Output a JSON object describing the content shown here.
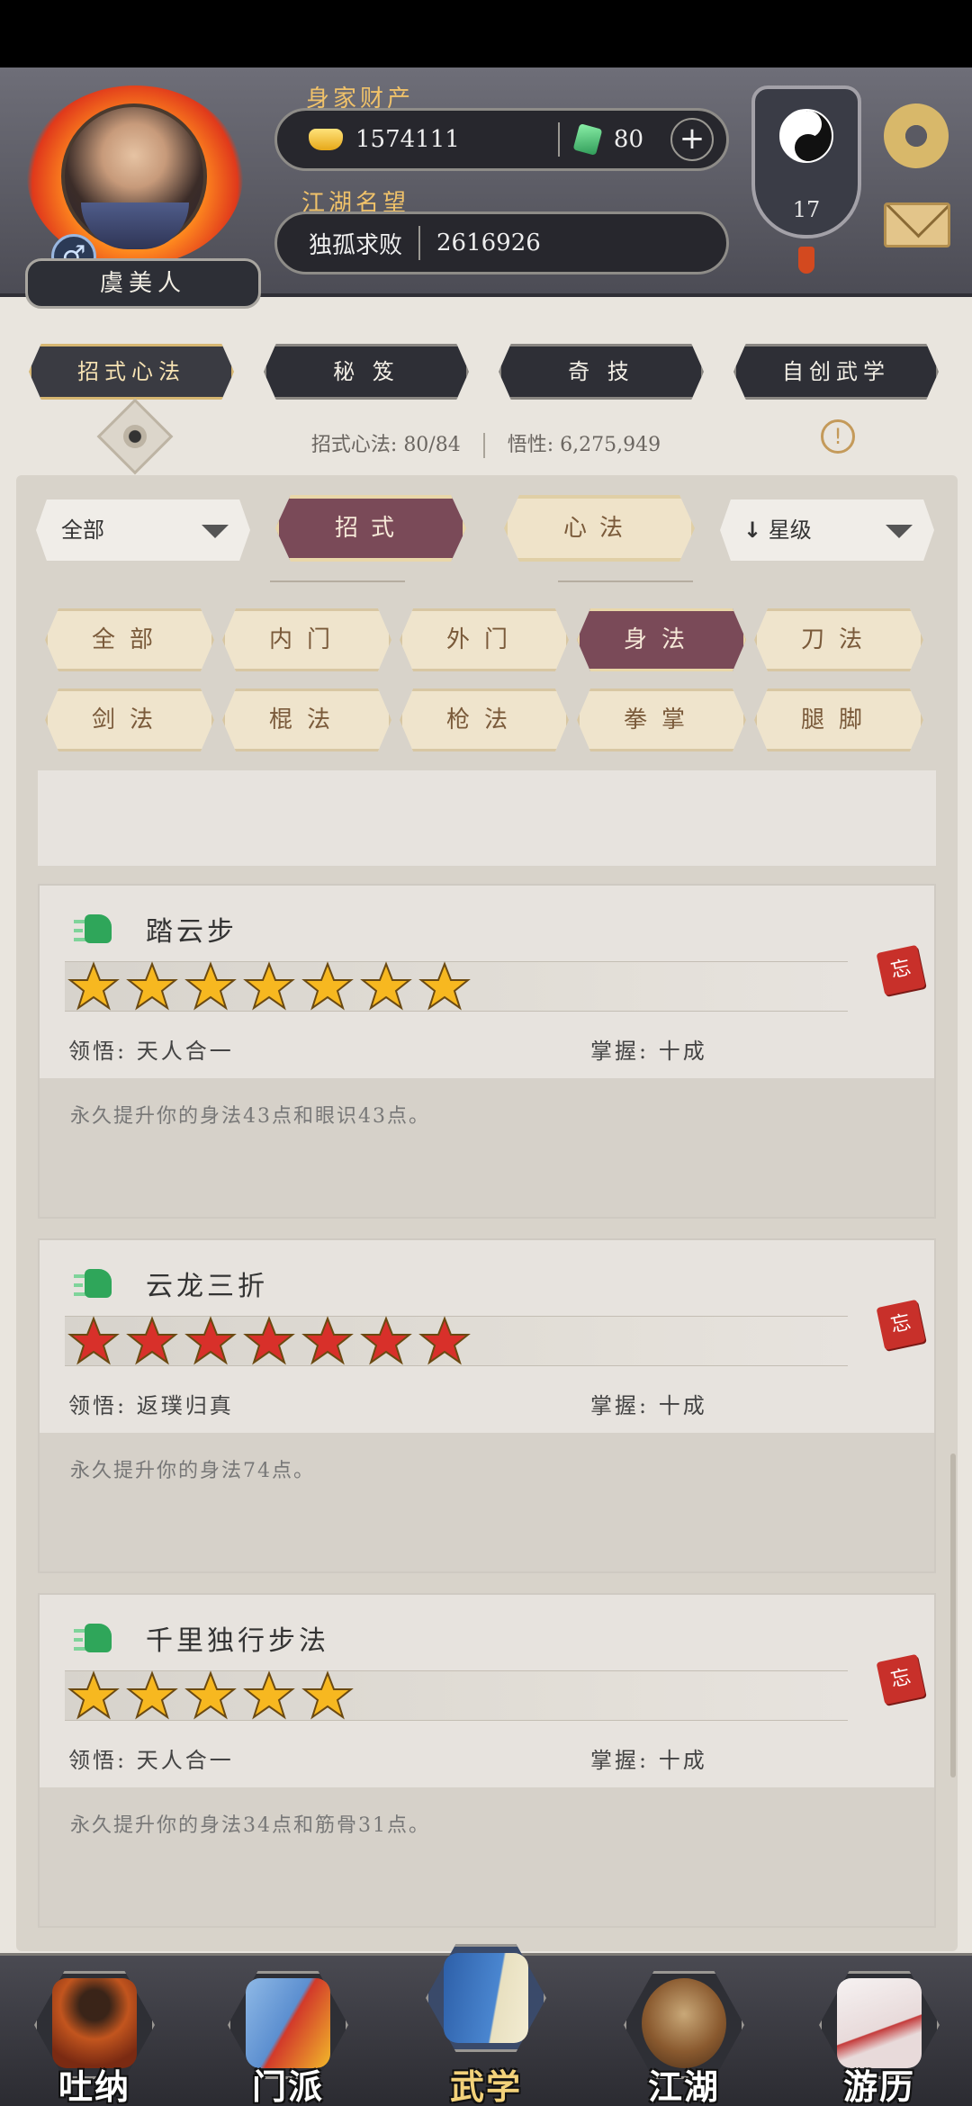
{
  "colors": {
    "accent_maroon": "#7a4a58",
    "accent_gold": "#f0c26a",
    "star_gold": "#f7b820",
    "star_red": "#d8302a",
    "forget_red": "#c8302a"
  },
  "header": {
    "wealth_label": "身家财产",
    "gold_value": "1574111",
    "jade_value": "80",
    "fame_label": "江湖名望",
    "fame_title": "独孤求败",
    "fame_value": "2616926",
    "player_name": "虞美人",
    "gender_symbol": "♂",
    "level": "17",
    "icons": [
      "gold-ingot-icon",
      "jade-icon",
      "plus-icon",
      "taiji-icon",
      "gear-icon",
      "mail-icon"
    ]
  },
  "top_tabs": [
    {
      "label": "招式心法",
      "active": true
    },
    {
      "label": "秘 笈",
      "active": false
    },
    {
      "label": "奇 技",
      "active": false
    },
    {
      "label": "自创武学",
      "active": false
    }
  ],
  "stats": {
    "moves_label": "招式心法:",
    "moves_value": "80/84",
    "comprehension_label": "悟性:",
    "comprehension_value": "6,275,949",
    "info_glyph": "!"
  },
  "filters": {
    "scope_dropdown": "全部",
    "main_tabs": [
      {
        "label": "招式",
        "active": true
      },
      {
        "label": "心法",
        "active": false
      }
    ],
    "sort_dropdown": "星级",
    "sort_arrow": "↓",
    "categories": [
      {
        "label": "全部",
        "active": false
      },
      {
        "label": "内门",
        "active": false
      },
      {
        "label": "外门",
        "active": false
      },
      {
        "label": "身法",
        "active": true
      },
      {
        "label": "刀法",
        "active": false
      },
      {
        "label": "剑法",
        "active": false
      },
      {
        "label": "棍法",
        "active": false
      },
      {
        "label": "枪法",
        "active": false
      },
      {
        "label": "拳掌",
        "active": false
      },
      {
        "label": "腿脚",
        "active": false
      }
    ]
  },
  "skills": [
    {
      "name": "踏云步",
      "stars": 7,
      "star_color": "gold",
      "insight_label": "领悟:",
      "insight_value": "天人合一",
      "mastery_label": "掌握:",
      "mastery_value": "十成",
      "description": "永久提升你的身法43点和眼识43点。",
      "forget_label": "忘"
    },
    {
      "name": "云龙三折",
      "stars": 7,
      "star_color": "red",
      "insight_label": "领悟:",
      "insight_value": "返璞归真",
      "mastery_label": "掌握:",
      "mastery_value": "十成",
      "description": "永久提升你的身法74点。",
      "forget_label": "忘"
    },
    {
      "name": "千里独行步法",
      "stars": 5,
      "star_color": "gold",
      "insight_label": "领悟:",
      "insight_value": "天人合一",
      "mastery_label": "掌握:",
      "mastery_value": "十成",
      "description": "永久提升你的身法34点和筋骨31点。",
      "forget_label": "忘"
    }
  ],
  "bottom_nav": [
    {
      "label": "吐纳",
      "active": false
    },
    {
      "label": "门派",
      "active": false
    },
    {
      "label": "武学",
      "active": true
    },
    {
      "label": "江湖",
      "active": false
    },
    {
      "label": "游历",
      "active": false
    }
  ]
}
